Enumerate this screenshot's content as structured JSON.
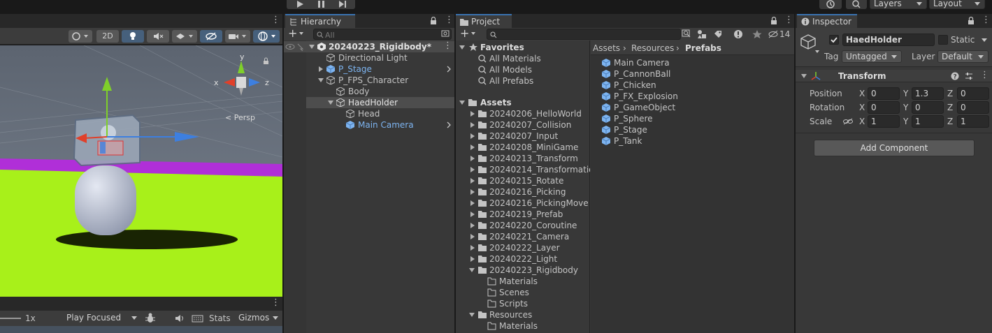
{
  "toolbar": {
    "layers_label": "Layers",
    "layout_label": "Layout"
  },
  "scene": {
    "btn_2d": "2D",
    "persp_label": "< Persp",
    "axis_x": "x",
    "axis_y": "y",
    "axis_z": "z"
  },
  "game": {
    "scale_label": "1x",
    "play_mode": "Play Focused",
    "stats_label": "Stats",
    "gizmos_label": "Gizmos"
  },
  "hierarchy": {
    "tab_label": "Hierarchy",
    "search_placeholder": "All",
    "scene_name": "20240223_Rigidbody*",
    "items": [
      {
        "label": "Directional Light"
      },
      {
        "label": "P_Stage"
      },
      {
        "label": "P_FPS_Character"
      },
      {
        "label": "Body"
      },
      {
        "label": "HaedHolder"
      },
      {
        "label": "Head"
      },
      {
        "label": "Main Camera"
      }
    ]
  },
  "project": {
    "tab_label": "Project",
    "hidden_count": "14",
    "favorites_label": "Favorites",
    "favorites": [
      "All Materials",
      "All Models",
      "All Prefabs"
    ],
    "assets_label": "Assets",
    "folders": [
      "20240206_HelloWorld",
      "20240207_Collision",
      "20240207_Input",
      "20240208_MiniGame",
      "20240213_Transform",
      "20240214_Transformatio",
      "20240215_Rotate",
      "20240216_Picking",
      "20240216_PickingMove",
      "20240219_Prefab",
      "20240220_Coroutine",
      "20240221_Camera",
      "20240222_Layer",
      "20240222_Light",
      "20240223_Rigidbody"
    ],
    "rigidbody_children": [
      "Materials",
      "Scenes",
      "Scripts"
    ],
    "resources_label": "Resources",
    "resources_children": [
      "Materials"
    ],
    "breadcrumb": [
      "Assets",
      "Resources",
      "Prefabs"
    ],
    "prefabs": [
      "Main Camera",
      "P_CannonBall",
      "P_Chicken",
      "P_FX_Explosion",
      "P_GameObject",
      "P_Sphere",
      "P_Stage",
      "P_Tank"
    ]
  },
  "inspector": {
    "tab_label": "Inspector",
    "object_name": "HaedHolder",
    "static_label": "Static",
    "tag_label": "Tag",
    "tag_value": "Untagged",
    "layer_label": "Layer",
    "layer_value": "Default",
    "transform_label": "Transform",
    "position_label": "Position",
    "rotation_label": "Rotation",
    "scale_label": "Scale",
    "x": "X",
    "y": "Y",
    "z": "Z",
    "position": [
      "0",
      "1.3",
      "0"
    ],
    "rotation": [
      "0",
      "0",
      "0"
    ],
    "scale": [
      "1",
      "1",
      "1"
    ],
    "add_component": "Add Component"
  },
  "colors": {
    "accent": "#3a72b0",
    "selection": "#4d4d4d",
    "prefab_blue": "#7db4f0",
    "ground_green": "#a8f01a",
    "stage_purple": "#b02fd8"
  }
}
